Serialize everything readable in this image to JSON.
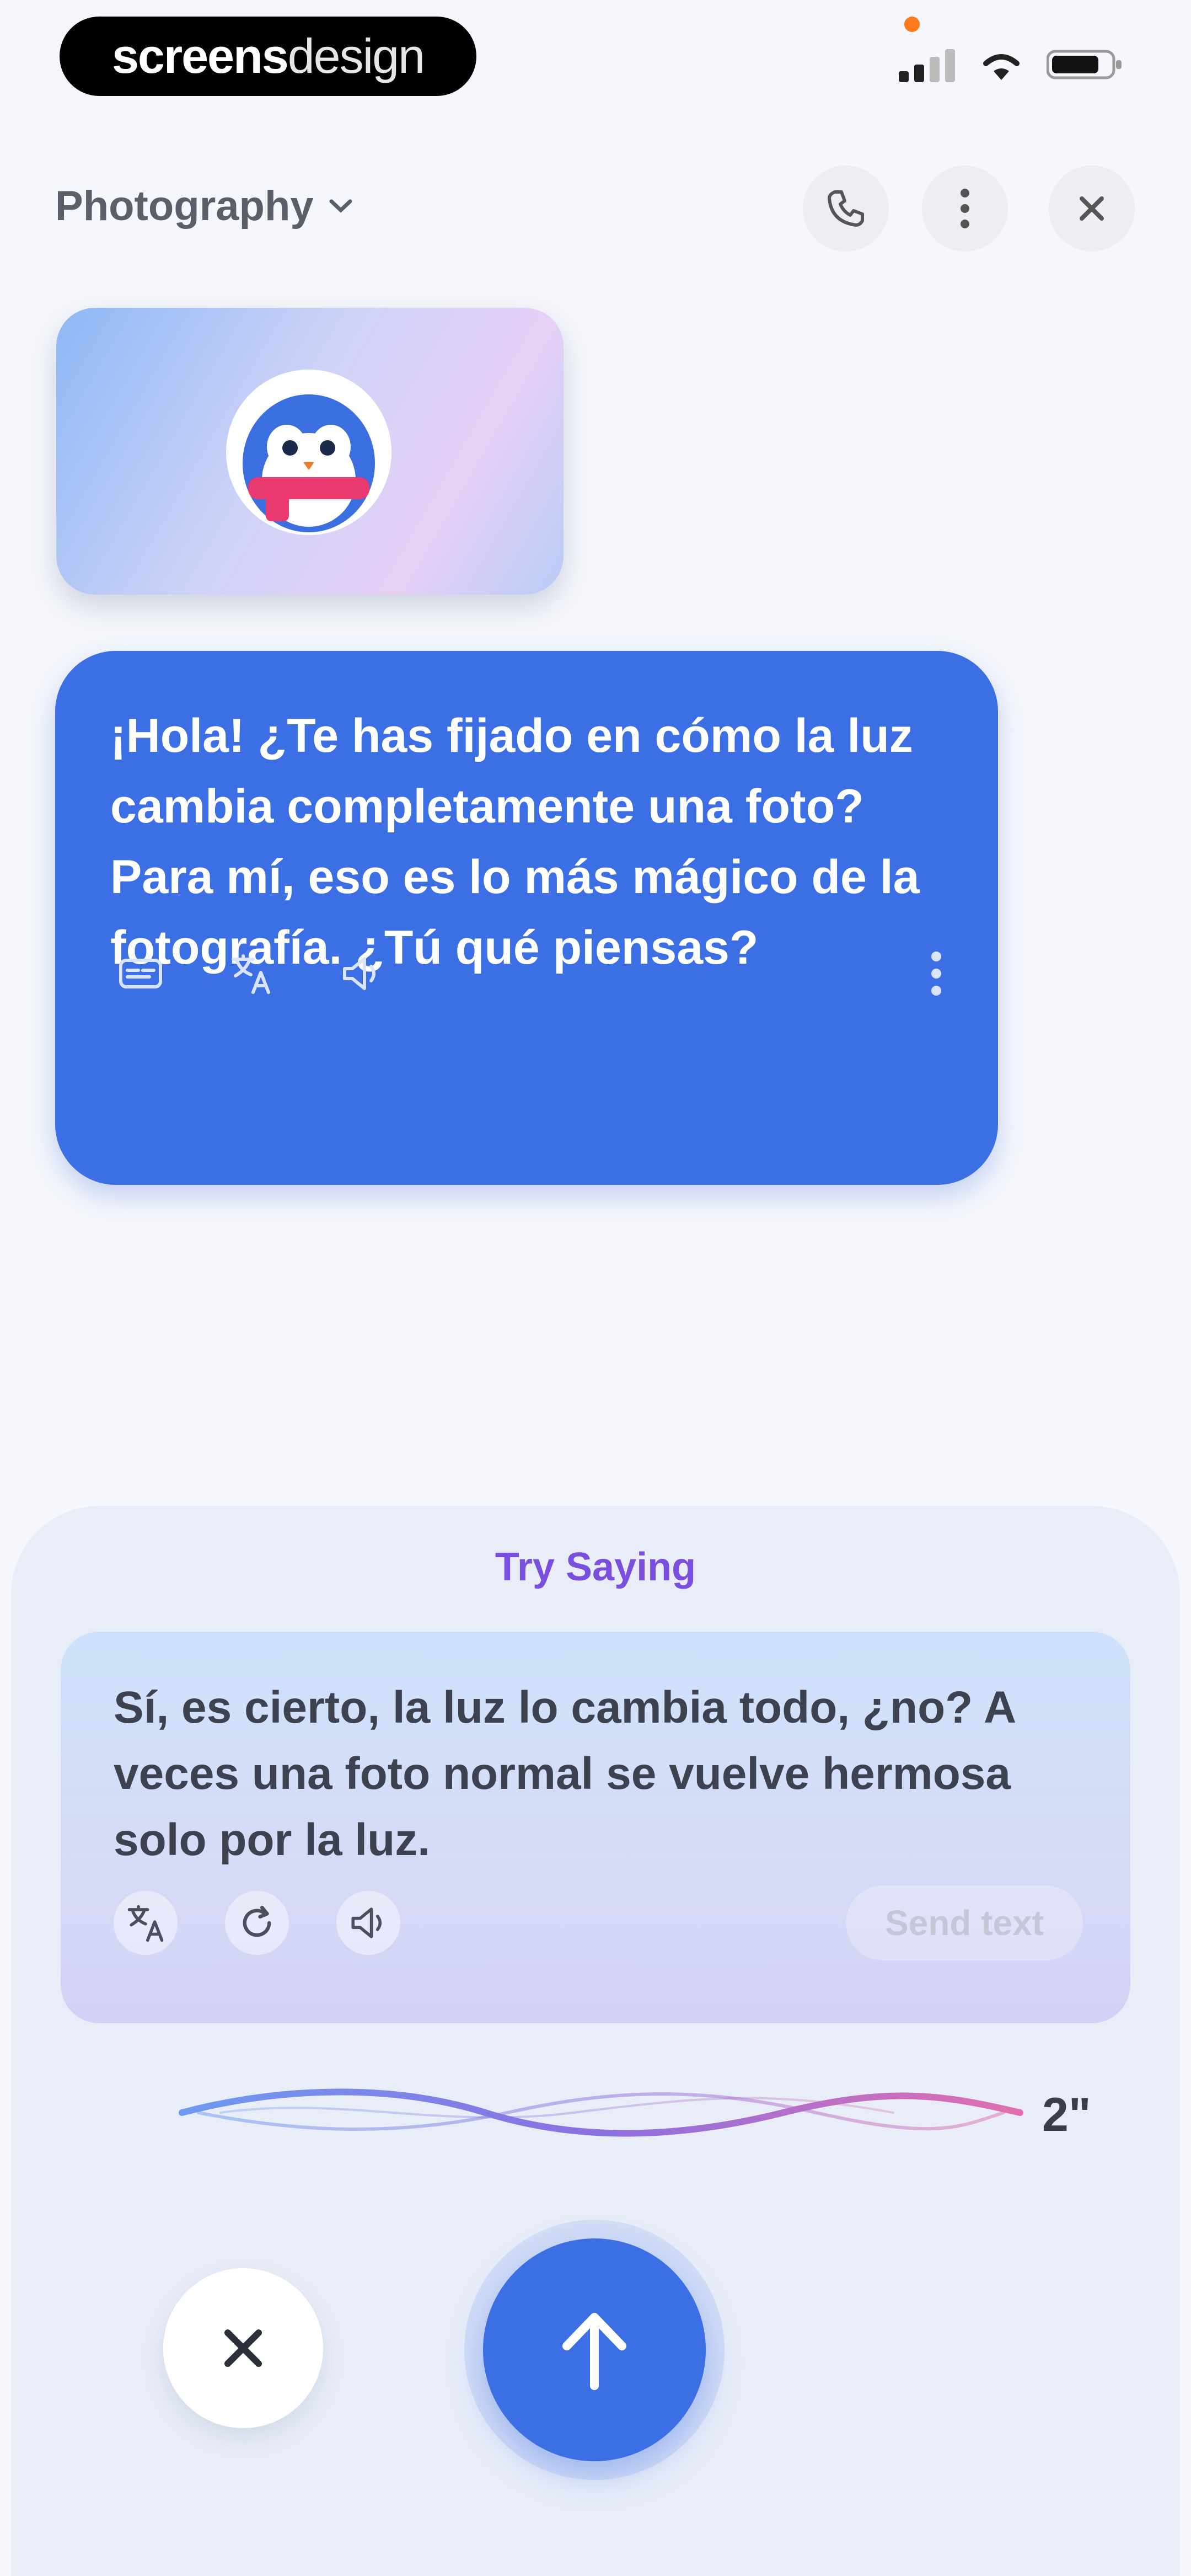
{
  "status_bar": {
    "brand_bold": "screens",
    "brand_light": "design",
    "icons": [
      "signal-icon",
      "wifi-icon",
      "battery-icon"
    ]
  },
  "header": {
    "topic": "Photography",
    "buttons": [
      "phone-icon",
      "more-vertical-icon",
      "close-icon"
    ]
  },
  "message": {
    "text": "¡Hola! ¿Te has fijado en cómo la luz cambia completamente una foto? Para mí, eso es lo más mágico de la fotografía. ¿Tú qué piensas?",
    "tools": [
      "subtitles-icon",
      "translate-icon",
      "speaker-icon",
      "more-vertical-icon"
    ]
  },
  "suggestion_panel": {
    "title": "Try Saying",
    "text": "Sí, es cierto, la luz lo cambia todo, ¿no? A veces una foto normal se vuelve hermosa solo por la luz.",
    "send_label": "Send text",
    "tools": [
      "translate-icon",
      "refresh-icon",
      "speaker-icon"
    ]
  },
  "recording": {
    "duration": "2\""
  },
  "colors": {
    "primary": "#3d6fe4",
    "accent_purple": "#7a4fe0",
    "background": "#f5f7fc",
    "sheet": "#e8edf8"
  }
}
